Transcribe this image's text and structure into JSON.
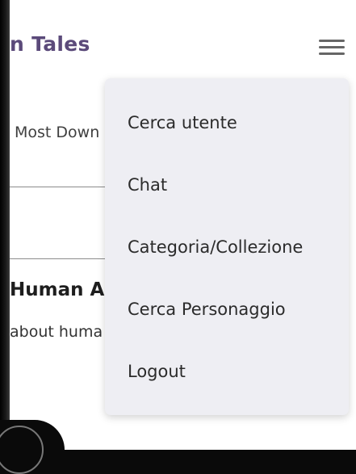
{
  "header": {
    "brand": "n Tales",
    "menu_icon": "hamburger-menu-icon"
  },
  "background": {
    "tab_label": "Most Down",
    "story_title": "Human A",
    "story_desc": "about huma"
  },
  "dropdown": {
    "items": [
      {
        "label": "Cerca utente"
      },
      {
        "label": "Chat"
      },
      {
        "label": "Categoria/Collezione"
      },
      {
        "label": "Cerca Personaggio"
      },
      {
        "label": "Logout"
      }
    ]
  },
  "colors": {
    "brand": "#5b4a7a",
    "dropdown_bg": "#eeeef3",
    "menu_icon": "#666666"
  }
}
